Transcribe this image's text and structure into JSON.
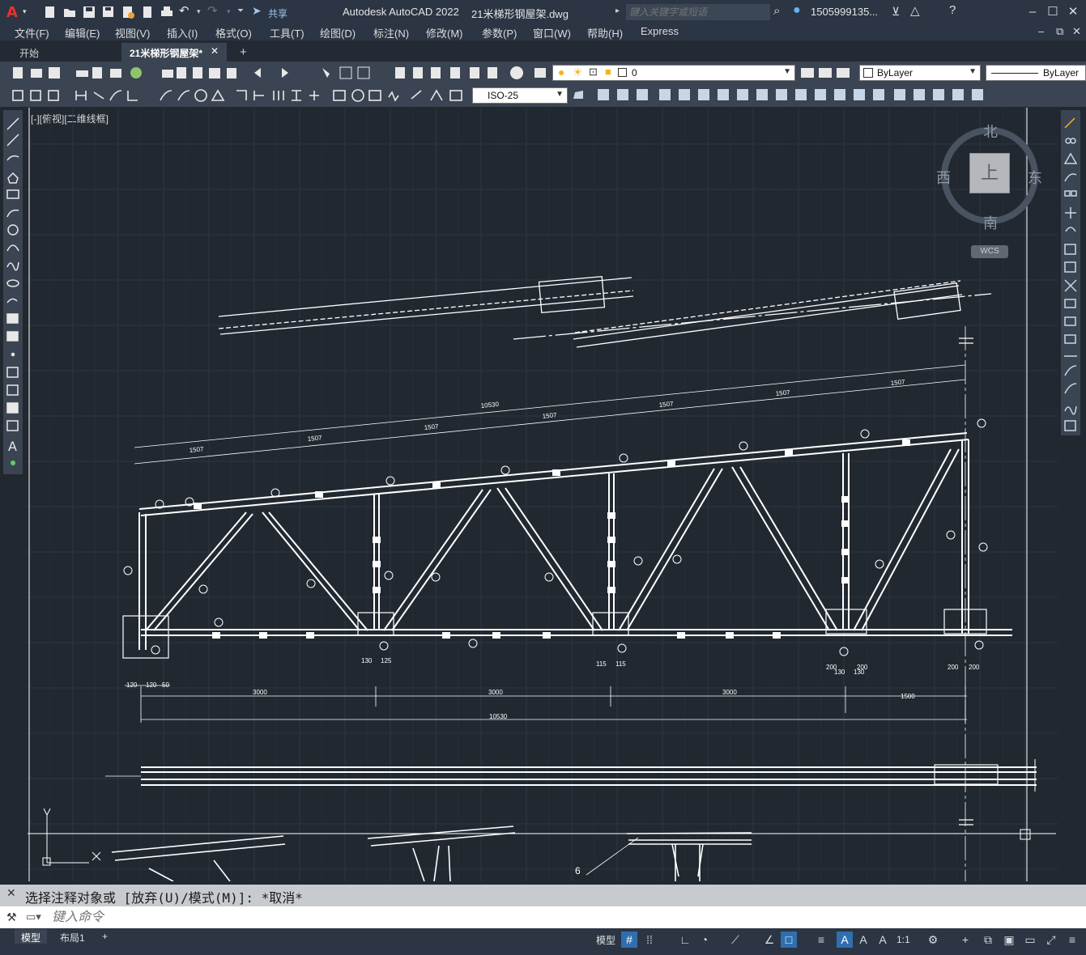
{
  "app": {
    "title": "Autodesk AutoCAD 2022",
    "file_title": "21米梯形钢屋架.dwg",
    "search_placeholder": "键入关键字或短语",
    "user": "1505999135...",
    "share_label": "共享"
  },
  "menu": [
    "文件(F)",
    "编辑(E)",
    "视图(V)",
    "插入(I)",
    "格式(O)",
    "工具(T)",
    "绘图(D)",
    "标注(N)",
    "修改(M)",
    "参数(P)",
    "窗口(W)",
    "帮助(H)",
    "Express"
  ],
  "tabs": [
    "开始",
    "21米梯形钢屋架*"
  ],
  "layer": {
    "current": "0",
    "color": "ByLayer",
    "linetype": "ByLayer"
  },
  "dimstyle": "ISO-25",
  "viewport": {
    "label": "[-][俯视][二维线框]"
  },
  "viewcube": {
    "north": "北",
    "south": "南",
    "east": "东",
    "west": "西",
    "face": "上",
    "wcs": "WCS"
  },
  "drawing": {
    "dims": [
      "1507",
      "1507",
      "1507",
      "1507",
      "1507",
      "1507",
      "1507",
      "10530"
    ],
    "bottom_dims": [
      "3000",
      "3000",
      "3000",
      "1500"
    ],
    "bottom_total": "10530",
    "left_dims": [
      "120",
      "120",
      "50"
    ],
    "small_dims": [
      "130",
      "125",
      "115",
      "115",
      "200",
      "200",
      "200",
      "200",
      "130",
      "130"
    ],
    "label_6": "6"
  },
  "command": {
    "history": "选择注释对象或 [放弃(U)/模式(M)]: *取消*",
    "placeholder": "键入命令"
  },
  "status": {
    "tabs": [
      "模型",
      "布局1"
    ],
    "model_label": "模型",
    "scale": "1:1"
  }
}
